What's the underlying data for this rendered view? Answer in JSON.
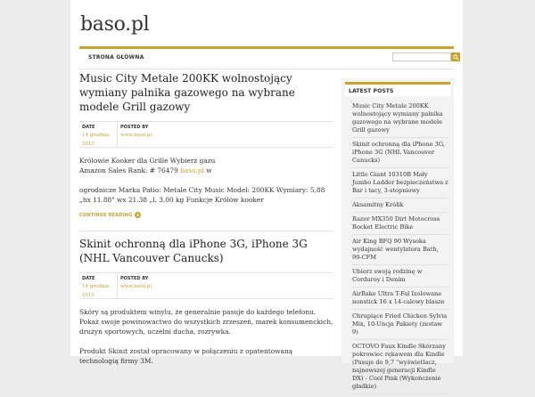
{
  "site": {
    "title": "baso.pl"
  },
  "nav": {
    "items": [
      {
        "label": "STRONA GŁÓWNA"
      }
    ]
  },
  "search": {
    "value": "",
    "placeholder": ""
  },
  "posts": [
    {
      "title": "Music City Metale 200KK wolnostojący wymiany palnika gazowego na wybrane modele Grill gazowy",
      "meta": {
        "date_label": "DATE",
        "date": "14 grudnia 2015",
        "author_label": "POSTED BY",
        "author": "www.baso.pl"
      },
      "paragraph1_line1": "Królowie Kooker dla Grille Wybierz gazu",
      "paragraph1_line2_before": "Amazon Sales Rank: # 76479 ",
      "paragraph1_link": "baso.pl",
      "paragraph1_line2_after": " w",
      "paragraph2": "ogrodnicze Marka Patio: Metale City Music Model: 200KK Wymiary: 5,88 „hx 11.88\" wx 21.38 „l, 3,00 kg Funkcje Królów kooker",
      "continue": "CONTINUE READING"
    },
    {
      "title": "Skinit ochronną dla iPhone 3G, iPhone 3G (NHL Vancouver Canucks)",
      "meta": {
        "date_label": "DATE",
        "date": "14 grudnia 2015",
        "author_label": "POSTED BY",
        "author": "www.baso.pl"
      },
      "paragraph1": "Skóry są produktem winylu, że generalnie pasuje do każdego telefonu. Pokaż swoje powinowactwo do wszystkich zrzeszeń, marek konsumenckich, drużyn sportowych, uczelni ducha, rozrywka.",
      "paragraph2": "Produkt Skinit został opracowany w połączeniu z opatentowaną technologią firmy 3M."
    }
  ],
  "sidebar": {
    "title": "LATEST POSTS",
    "items": [
      "Music City Metale 200KK wolnostojący wymiany palnika gazowego na wybrane modele Grill gazowy",
      "Skinit ochronną dla iPhone 3G, iPhone 3G (NHL Vancouver Canucks)",
      "Little Giant 10310B Mały Jumbo Ladder bezpieczeństwa z Bar i tacy, 3-stopniowy",
      "Aksamitny Królik",
      "Razor MX350 Dirt Motocross Rocket Electric Bike",
      "Air King BFQ 90 Wysoka wydajność wentylatora Bath, 90-CFM",
      "Ubierz swoją rodzinę w Corduroy i Denim",
      "AirBake Ultra T-Fal Izolowane nonstick 16 x 14-calowy blasze",
      "Chrupiące Fried Chicken Sylvia Mix, 10-Uncja Pakiety (zestaw 9)",
      "OCTOVO Faux Kindle Skórzany pokrowiec rękawem dla Kindle (Pasuje do 9,7 \"wyświetlacz, najnowszej generacji Kindle DX) - Cool Pink (Wykończenie gładkie)"
    ]
  },
  "colors": {
    "accent": "#c9a227",
    "page_bg": "#ececec",
    "sidebar_bg": "#f3f3f3"
  },
  "icons": {
    "search": "search-icon",
    "continue": "arrow-right-icon"
  }
}
